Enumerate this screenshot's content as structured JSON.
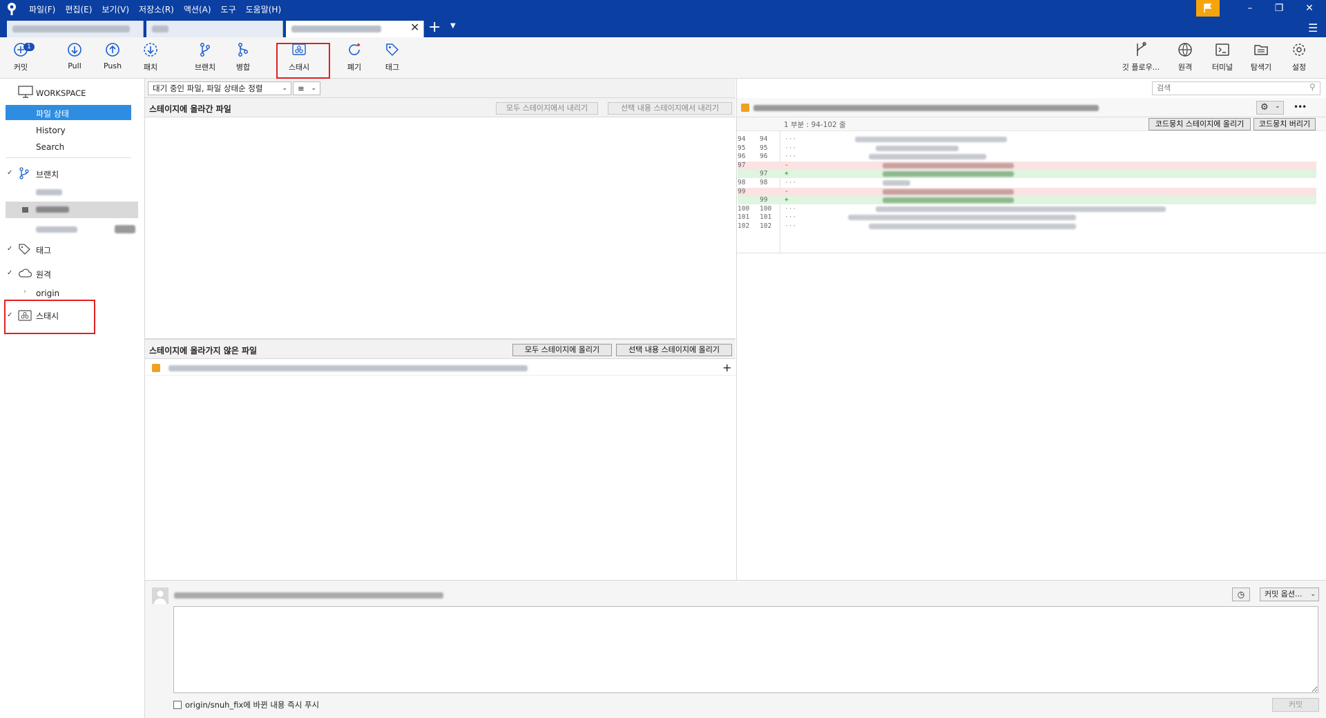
{
  "menu": {
    "items": [
      "파일(F)",
      "편집(E)",
      "보기(V)",
      "저장소(R)",
      "액션(A)",
      "도구",
      "도움말(H)"
    ]
  },
  "toolbar": {
    "commit": "커밋",
    "commit_badge": "1",
    "pull": "Pull",
    "push": "Push",
    "fetch": "패치",
    "branch": "브랜치",
    "merge": "병합",
    "stash": "스태시",
    "discard": "폐기",
    "tag": "태그",
    "git_flow": "깃 플로우...",
    "remote": "원격",
    "terminal": "터미널",
    "explorer": "탐색기",
    "settings": "설정"
  },
  "sidebar": {
    "workspace": "WORKSPACE",
    "file_status": "파일 상태",
    "history": "History",
    "search": "Search",
    "branches": "브랜치",
    "tags": "태그",
    "remotes": "원격",
    "origin": "origin",
    "stashes": "스태시"
  },
  "filter": {
    "sort_label": "대기 중인 파일, 파일 상태순 정렬",
    "view_icon": "≡"
  },
  "staged": {
    "title": "스테이지에 올라간 파일",
    "unstage_all": "모두 스테이지에서 내리기",
    "unstage_selected": "선택 내용 스테이지에서 내리기"
  },
  "unstaged": {
    "title": "스테이지에 올라가지 않은 파일",
    "stage_all": "모두 스테이지에 올리기",
    "stage_selected": "선택 내용 스테이지에 올리기",
    "add_icon": "+"
  },
  "diff": {
    "search_placeholder": "검색",
    "hunk_header": "1 부분 : 94-102 줄",
    "stage_hunk": "코드뭉치 스테이지에 올리기",
    "discard_hunk": "코드뭉치 버리기",
    "more": "•••",
    "lines": [
      {
        "old": "94",
        "new": "94",
        "type": "ctx"
      },
      {
        "old": "95",
        "new": "95",
        "type": "ctx"
      },
      {
        "old": "96",
        "new": "96",
        "type": "ctx"
      },
      {
        "old": "97",
        "new": "",
        "type": "del"
      },
      {
        "old": "",
        "new": "97",
        "type": "add"
      },
      {
        "old": "98",
        "new": "98",
        "type": "ctx"
      },
      {
        "old": "99",
        "new": "",
        "type": "del"
      },
      {
        "old": "",
        "new": "99",
        "type": "add"
      },
      {
        "old": "100",
        "new": "100",
        "type": "ctx"
      },
      {
        "old": "101",
        "new": "101",
        "type": "ctx"
      },
      {
        "old": "102",
        "new": "102",
        "type": "ctx"
      }
    ]
  },
  "commit": {
    "options": "커밋 옵션...",
    "push_label": "origin/snuh_fix에 바뀐 내용 즉시 푸시",
    "commit_button": "커밋"
  },
  "colors": {
    "title_bar": "#0b3fa1",
    "selection": "#2e8de0",
    "highlight": "#e02020",
    "flag": "#f5a50b",
    "diff_add": "#dff5df",
    "diff_del": "#fbe3e3"
  }
}
